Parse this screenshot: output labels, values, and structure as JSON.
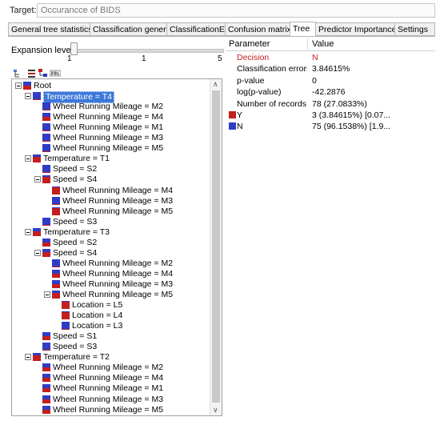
{
  "target": {
    "label": "Target:",
    "value": "Occurancce of BIDS"
  },
  "tabs": [
    {
      "label": "General tree statistics"
    },
    {
      "label": "Classification general"
    },
    {
      "label": "ClassificationEx"
    },
    {
      "label": "Confusion matrix"
    },
    {
      "label": "Tree"
    },
    {
      "label": "Predictor Importance"
    },
    {
      "label": "Settings"
    }
  ],
  "expansion": {
    "label": "Expansion level",
    "min": "1",
    "value": "1",
    "max": "5"
  },
  "toolbar": [
    {
      "icon": "tree-expand-icon"
    },
    {
      "icon": "tree-collapse-icon"
    },
    {
      "icon": "tree-layout-icon"
    },
    {
      "icon": "sql-export-icon"
    }
  ],
  "colors": {
    "y": "#c41e1e",
    "n": "#2f3cc4",
    "decision": "#c41e1e"
  },
  "tree": [
    {
      "label": "Root",
      "level": 0,
      "expander": true,
      "n_frac": 0.5
    },
    {
      "label": "Temperature = T4",
      "level": 1,
      "expander": true,
      "selected": true,
      "n_frac": 0.9
    },
    {
      "label": "Wheel Running Mileage = M2",
      "level": 2,
      "n_frac": 0.9
    },
    {
      "label": "Wheel Running Mileage = M4",
      "level": 2,
      "n_frac": 0.5
    },
    {
      "label": "Wheel Running Mileage = M1",
      "level": 2,
      "n_frac": 0.9
    },
    {
      "label": "Wheel Running Mileage = M3",
      "level": 2,
      "n_frac": 0.9
    },
    {
      "label": "Wheel Running Mileage = M5",
      "level": 2,
      "n_frac": 0.9
    },
    {
      "label": "Temperature = T1",
      "level": 1,
      "expander": true,
      "n_frac": 0.3
    },
    {
      "label": "Speed = S2",
      "level": 2,
      "n_frac": 0.9
    },
    {
      "label": "Speed = S4",
      "level": 2,
      "expander": true,
      "n_frac": 0.2
    },
    {
      "label": "Wheel Running Mileage = M4",
      "level": 3,
      "n_frac": 0.1
    },
    {
      "label": "Wheel Running Mileage = M3",
      "level": 3,
      "n_frac": 0.9
    },
    {
      "label": "Wheel Running Mileage = M5",
      "level": 3,
      "n_frac": 0.1
    },
    {
      "label": "Speed = S3",
      "level": 2,
      "n_frac": 0.9
    },
    {
      "label": "Temperature = T3",
      "level": 1,
      "expander": true,
      "n_frac": 0.4
    },
    {
      "label": "Speed = S2",
      "level": 2,
      "n_frac": 0.5
    },
    {
      "label": "Speed = S4",
      "level": 2,
      "expander": true,
      "n_frac": 0.4
    },
    {
      "label": "Wheel Running Mileage = M2",
      "level": 3,
      "n_frac": 0.9
    },
    {
      "label": "Wheel Running Mileage = M4",
      "level": 3,
      "n_frac": 0.5
    },
    {
      "label": "Wheel Running Mileage = M3",
      "level": 3,
      "n_frac": 0.5
    },
    {
      "label": "Wheel Running Mileage = M5",
      "level": 3,
      "expander": true,
      "n_frac": 0.3
    },
    {
      "label": "Location = L5",
      "level": 4,
      "n_frac": 0.1
    },
    {
      "label": "Location = L4",
      "level": 4,
      "n_frac": 0.1
    },
    {
      "label": "Location = L3",
      "level": 4,
      "n_frac": 0.9
    },
    {
      "label": "Speed = S1",
      "level": 2,
      "n_frac": 0.5
    },
    {
      "label": "Speed = S3",
      "level": 2,
      "n_frac": 0.9
    },
    {
      "label": "Temperature = T2",
      "level": 1,
      "expander": true,
      "n_frac": 0.3
    },
    {
      "label": "Wheel Running Mileage = M2",
      "level": 2,
      "n_frac": 0.5
    },
    {
      "label": "Wheel Running Mileage = M4",
      "level": 2,
      "n_frac": 0.5
    },
    {
      "label": "Wheel Running Mileage = M1",
      "level": 2,
      "n_frac": 0.5
    },
    {
      "label": "Wheel Running Mileage = M3",
      "level": 2,
      "n_frac": 0.5
    },
    {
      "label": "Wheel Running Mileage = M5",
      "level": 2,
      "n_frac": 0.5
    }
  ],
  "grid": {
    "headers": {
      "param": "Parameter",
      "value": "Value"
    },
    "rows": [
      {
        "param": "Decision",
        "value": "N",
        "red": true
      },
      {
        "param": "Classification errors",
        "value": "3.84615%"
      },
      {
        "param": "p-value",
        "value": "0"
      },
      {
        "param": "log(p-value)",
        "value": "-42.2876"
      },
      {
        "param": "Number of records",
        "value": "78 (27.0833%)"
      },
      {
        "param": "Y",
        "value": "3 (3.84615%) [0.07...",
        "legend": "y"
      },
      {
        "param": "N",
        "value": "75 (96.1538%) [1.9...",
        "legend": "n"
      }
    ]
  }
}
